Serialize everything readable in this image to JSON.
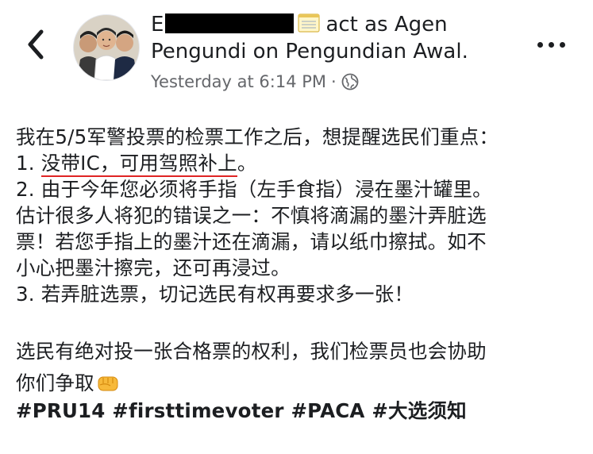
{
  "post": {
    "author_initial": "E",
    "author_rest": "act as Agen",
    "author_line2": "Pengundi on Pengundian Awal.",
    "timestamp": "Yesterday at 6:14 PM",
    "separator": "·",
    "privacy_icon": "globe-icon",
    "back_icon": "chevron-left-icon",
    "more_icon": "more-options-icon"
  },
  "content": {
    "line1": "我在5/5军警投票的检票工作之后，想提醒选民们重点：",
    "line2_prefix": "1. ",
    "line2_underlined": "没带IC，可用驾照补上",
    "line2_suffix": "。",
    "line3": "2. 由于今年您必须将手指（左手食指）浸在墨汁罐里。",
    "line4": "估计很多人将犯的错误之一：不慎将滴漏的墨汁弄脏选",
    "line5": "票！若您手指上的墨汁还在滴漏，请以纸巾擦拭。如不",
    "line6": "小心把墨汁擦完，还可再浸过。",
    "line7": "3. 若弄脏选票，切记选民有权再要求多一张！",
    "line8": "选民有绝对投一张合格票的权利，我们检票员也会协助",
    "line9": "你们争取",
    "fist_icon": "fist-emoji-icon",
    "hashtags": [
      "#PRU14",
      "#firsttimevoter",
      "#PACA",
      "#大选须知"
    ]
  },
  "colors": {
    "text": "#1c1e21",
    "meta": "#65676b",
    "underline": "#e02424",
    "redaction": "#000000"
  }
}
